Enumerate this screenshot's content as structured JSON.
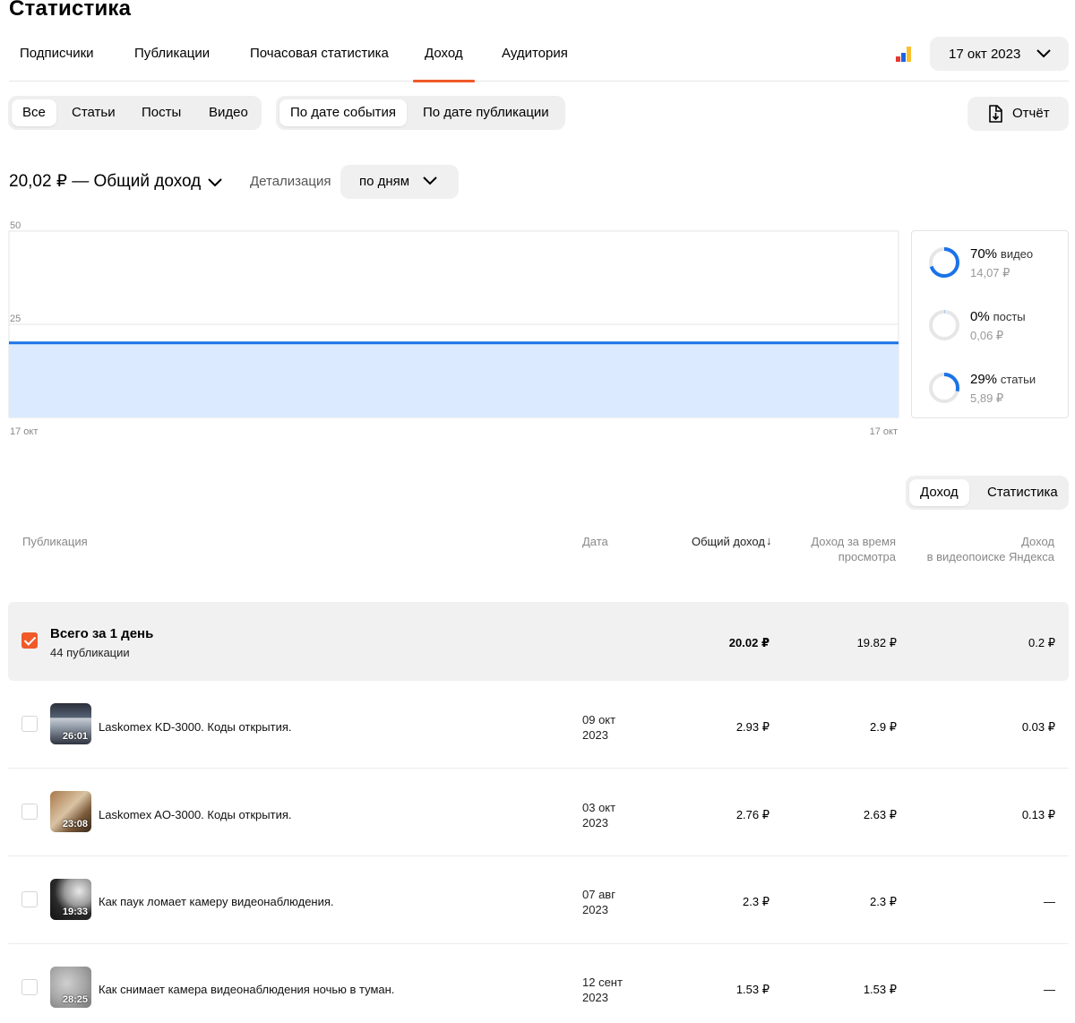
{
  "page": {
    "title": "Статистика"
  },
  "top_tabs": [
    {
      "label": "Подписчики"
    },
    {
      "label": "Публикации"
    },
    {
      "label": "Почасовая статистика"
    },
    {
      "label": "Доход",
      "active": true
    },
    {
      "label": "Аудитория"
    }
  ],
  "date_picker": {
    "value": "17 окт 2023"
  },
  "content_filter": {
    "items": [
      "Все",
      "Статьи",
      "Посты",
      "Видео"
    ],
    "selected": "Все"
  },
  "date_mode": {
    "items": [
      "По дате события",
      "По дате публикации"
    ],
    "selected": "По дате события"
  },
  "report_button": {
    "label": "Отчёт"
  },
  "summary": {
    "total_text": "20,02 ₽ — Общий доход",
    "detail_label": "Детализация",
    "detail_value": "по дням"
  },
  "chart_data": {
    "type": "area",
    "x": [
      "17 окт",
      "17 окт"
    ],
    "series": [
      {
        "values": [
          20.02,
          20.02
        ]
      }
    ],
    "yticks": [
      "50",
      "25",
      "0"
    ],
    "ylim": [
      0,
      50
    ],
    "grid": true,
    "color": "#1a73e8",
    "fill": "#dbeafe"
  },
  "split": [
    {
      "pct": "70%",
      "category": "видео",
      "amount": "14,07 ₽",
      "fraction": 0.7
    },
    {
      "pct": "0%",
      "category": "посты",
      "amount": "0,06 ₽",
      "fraction": 0.003
    },
    {
      "pct": "29%",
      "category": "статьи",
      "amount": "5,89 ₽",
      "fraction": 0.29
    }
  ],
  "table_toggle": {
    "items": [
      "Доход",
      "Статистика"
    ],
    "selected": "Доход"
  },
  "table": {
    "headers": {
      "publication": "Публикация",
      "date": "Дата",
      "total": "Общий доход",
      "watch_l1": "Доход за время",
      "watch_l2": "просмотра",
      "search_l1": "Доход",
      "search_l2": "в видеопоиске Яндекса"
    },
    "total_row": {
      "title": "Всего за 1 день",
      "subtitle": "44 публикации",
      "total": "20.02 ₽",
      "watch": "19.82 ₽",
      "search": "0.2 ₽"
    },
    "rows": [
      {
        "title": "Laskomex KD-3000. Коды открытия.",
        "duration": "26:01",
        "date_l1": "09 окт",
        "date_l2": "2023",
        "total": "2.93 ₽",
        "watch": "2.9 ₽",
        "search": "0.03 ₽"
      },
      {
        "title": "Laskomex AO-3000. Коды открытия.",
        "duration": "23:08",
        "date_l1": "03 окт",
        "date_l2": "2023",
        "total": "2.76 ₽",
        "watch": "2.63 ₽",
        "search": "0.13 ₽"
      },
      {
        "title": "Как паук ломает камеру видеонаблюдения.",
        "duration": "19:33",
        "date_l1": "07 авг",
        "date_l2": "2023",
        "total": "2.3 ₽",
        "watch": "2.3 ₽",
        "search": "—"
      },
      {
        "title": "Как снимает камера видеонаблюдения ночью в туман.",
        "duration": "28:25",
        "date_l1": "12 сент",
        "date_l2": "2023",
        "total": "1.53 ₽",
        "watch": "1.53 ₽",
        "search": "—"
      }
    ]
  }
}
